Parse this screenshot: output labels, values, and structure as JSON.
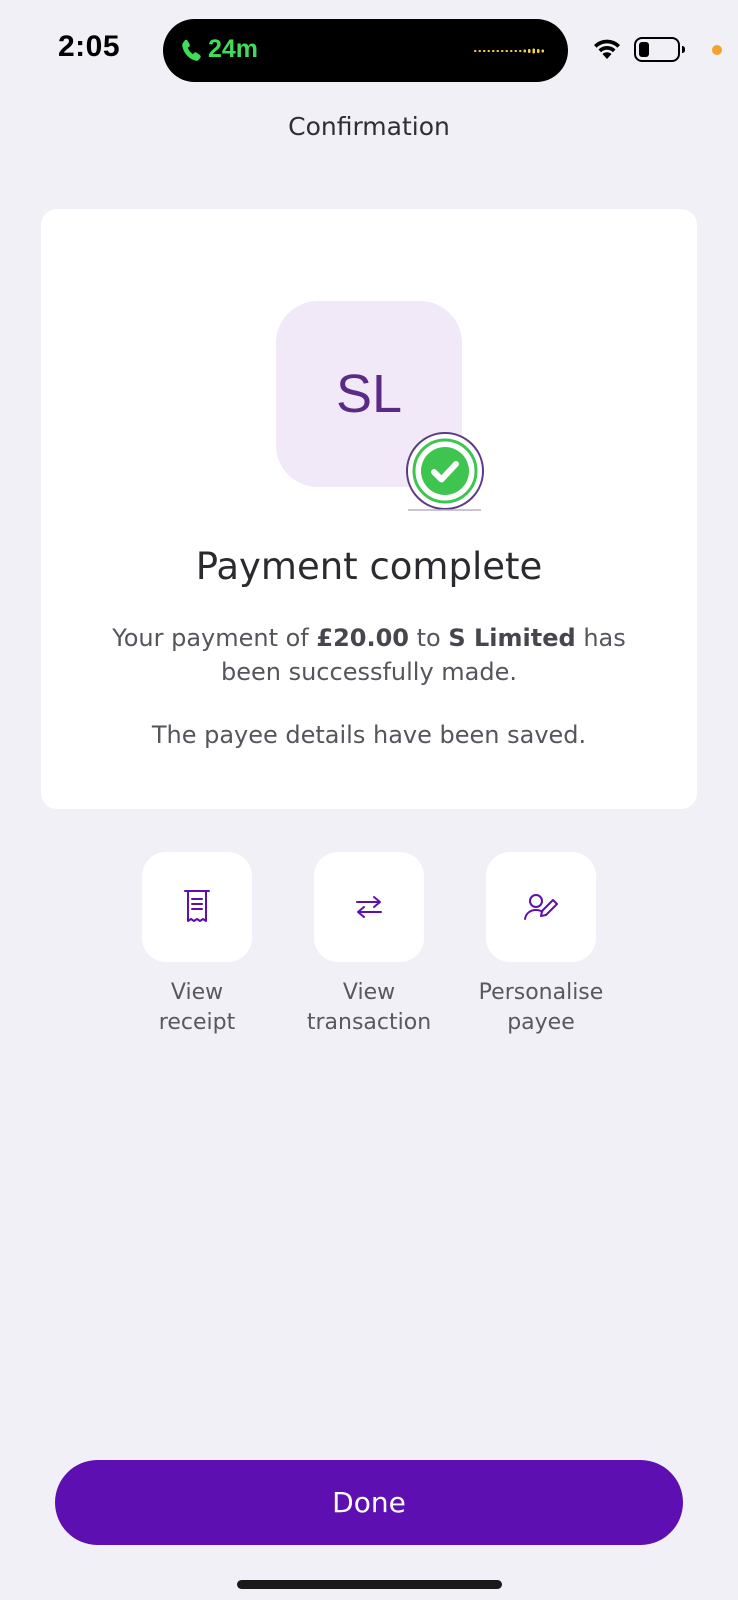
{
  "status_bar": {
    "time": "2:05",
    "call_duration": "24m",
    "colors": {
      "call_green": "#3ede5a",
      "mic_dot": "#f7a02b"
    }
  },
  "header": {
    "title": "Confirmation"
  },
  "card": {
    "avatar_initials": "SL",
    "heading": "Payment complete",
    "message": {
      "part1": "Your payment of ",
      "amount": "£20.00",
      "part2": " to ",
      "payee": "S Limited",
      "part3": " has been successfully made."
    },
    "note": "The payee details have been saved."
  },
  "actions": [
    {
      "icon": "receipt-icon",
      "line1": "View",
      "line2": "receipt"
    },
    {
      "icon": "transfer-arrows-icon",
      "line1": "View",
      "line2": "transaction"
    },
    {
      "icon": "person-edit-icon",
      "line1": "Personalise",
      "line2": "payee"
    }
  ],
  "done_button": {
    "label": "Done"
  },
  "colors": {
    "background": "#f1f0f6",
    "accent": "#5d0fb2",
    "avatar_bg": "#f1e8f8",
    "success_green": "#3ec54f"
  }
}
